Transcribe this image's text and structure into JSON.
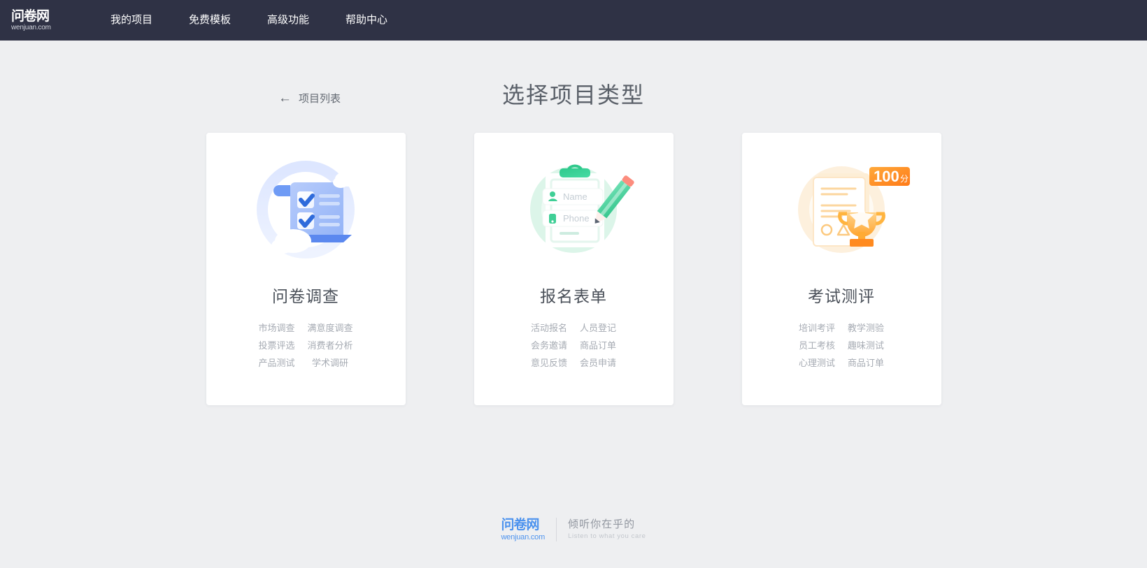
{
  "navbar": {
    "brand_cn": "问卷网",
    "brand_en": "wenjuan.com",
    "items": [
      {
        "label": "我的项目"
      },
      {
        "label": "免费模板"
      },
      {
        "label": "高级功能"
      },
      {
        "label": "帮助中心"
      }
    ]
  },
  "header": {
    "back_label": "项目列表",
    "back_icon": "arrow-left-icon",
    "title": "选择项目类型"
  },
  "cards": [
    {
      "id": "survey",
      "title": "问卷调查",
      "art": "checklist-clipboard-illustration",
      "accent": "#4d7cf3",
      "tags": [
        "市场调查",
        "满意度调查",
        "投票评选",
        "消费者分析",
        "产品测试",
        "学术调研"
      ]
    },
    {
      "id": "registration-form",
      "title": "报名表单",
      "art": "form-clipboard-pencil-illustration",
      "accent": "#3fcf96",
      "art_labels": {
        "name_field": "Name",
        "phone_field": "Phone"
      },
      "tags": [
        "活动报名",
        "人员登记",
        "会务邀请",
        "商品订单",
        "意见反馈",
        "会员申请"
      ]
    },
    {
      "id": "exam-assessment",
      "title": "考试测评",
      "art": "exam-paper-trophy-illustration",
      "accent": "#ff9015",
      "art_labels": {
        "score_badge_number": "100",
        "score_badge_unit": "分"
      },
      "tags": [
        "培训考评",
        "教学测验",
        "员工考核",
        "趣味测试",
        "心理测试",
        "商品订单"
      ]
    }
  ],
  "footer": {
    "logo_cn": "问卷网",
    "logo_en": "wenjuan.com",
    "slogan_cn": "倾听你在乎的",
    "slogan_en": "Listen to what you care"
  },
  "colors": {
    "navbar_bg": "#2f3245",
    "page_bg": "#eeeff1",
    "card_bg": "#ffffff",
    "title_text": "#5a6069",
    "tag_text": "#a6abb3",
    "brand_blue": "#4d93ee"
  }
}
